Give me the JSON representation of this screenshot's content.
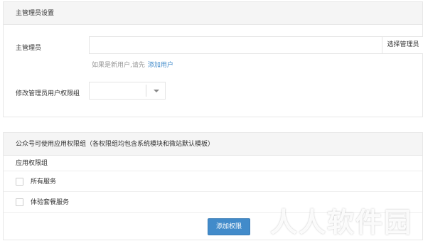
{
  "section1": {
    "title": "主管理员设置",
    "admin_label": "主管理员",
    "admin_value": "",
    "select_admin_button": "选择管理员",
    "hint_text": "如果是新用户,请先",
    "hint_link": "添加用户",
    "group_label": "修改管理员用户权限组",
    "group_value": ""
  },
  "section2": {
    "title": "公众号可使用应用权限组（各权限组均包含系统模块和微站默认模板）",
    "column_header": "应用权限组",
    "options": [
      {
        "label": "所有服务",
        "checked": false
      },
      {
        "label": "体验套餐服务",
        "checked": false
      }
    ],
    "add_button": "添加权限"
  },
  "watermark": "人人软件园"
}
